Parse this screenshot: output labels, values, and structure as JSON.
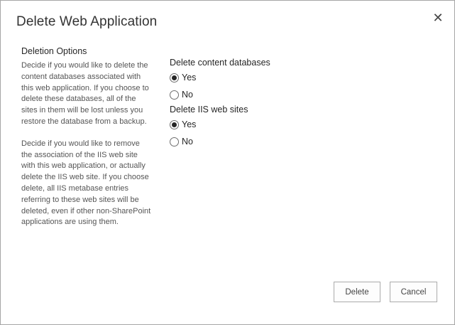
{
  "dialog": {
    "title": "Delete Web Application",
    "close_symbol": "✕"
  },
  "left": {
    "section_title": "Deletion Options",
    "desc1": "Decide if you would like to delete the content databases associated with this web application.  If you choose to delete these databases, all of the sites in them will be lost unless you restore the database from a backup.",
    "desc2": "Decide if you would like to remove the association of the IIS web site with this web application, or actually delete the IIS web site.  If you choose delete, all IIS metabase entries referring to these web sites will be deleted, even if other non-SharePoint applications are using them."
  },
  "content_db": {
    "label": "Delete content databases",
    "options": [
      {
        "label": "Yes",
        "checked": true
      },
      {
        "label": "No",
        "checked": false
      }
    ]
  },
  "iis": {
    "label": "Delete IIS web sites",
    "options": [
      {
        "label": "Yes",
        "checked": true
      },
      {
        "label": "No",
        "checked": false
      }
    ]
  },
  "buttons": {
    "delete": "Delete",
    "cancel": "Cancel"
  },
  "colors": {
    "border": "#a6a6a6",
    "text": "#262626",
    "muted": "#555555"
  }
}
